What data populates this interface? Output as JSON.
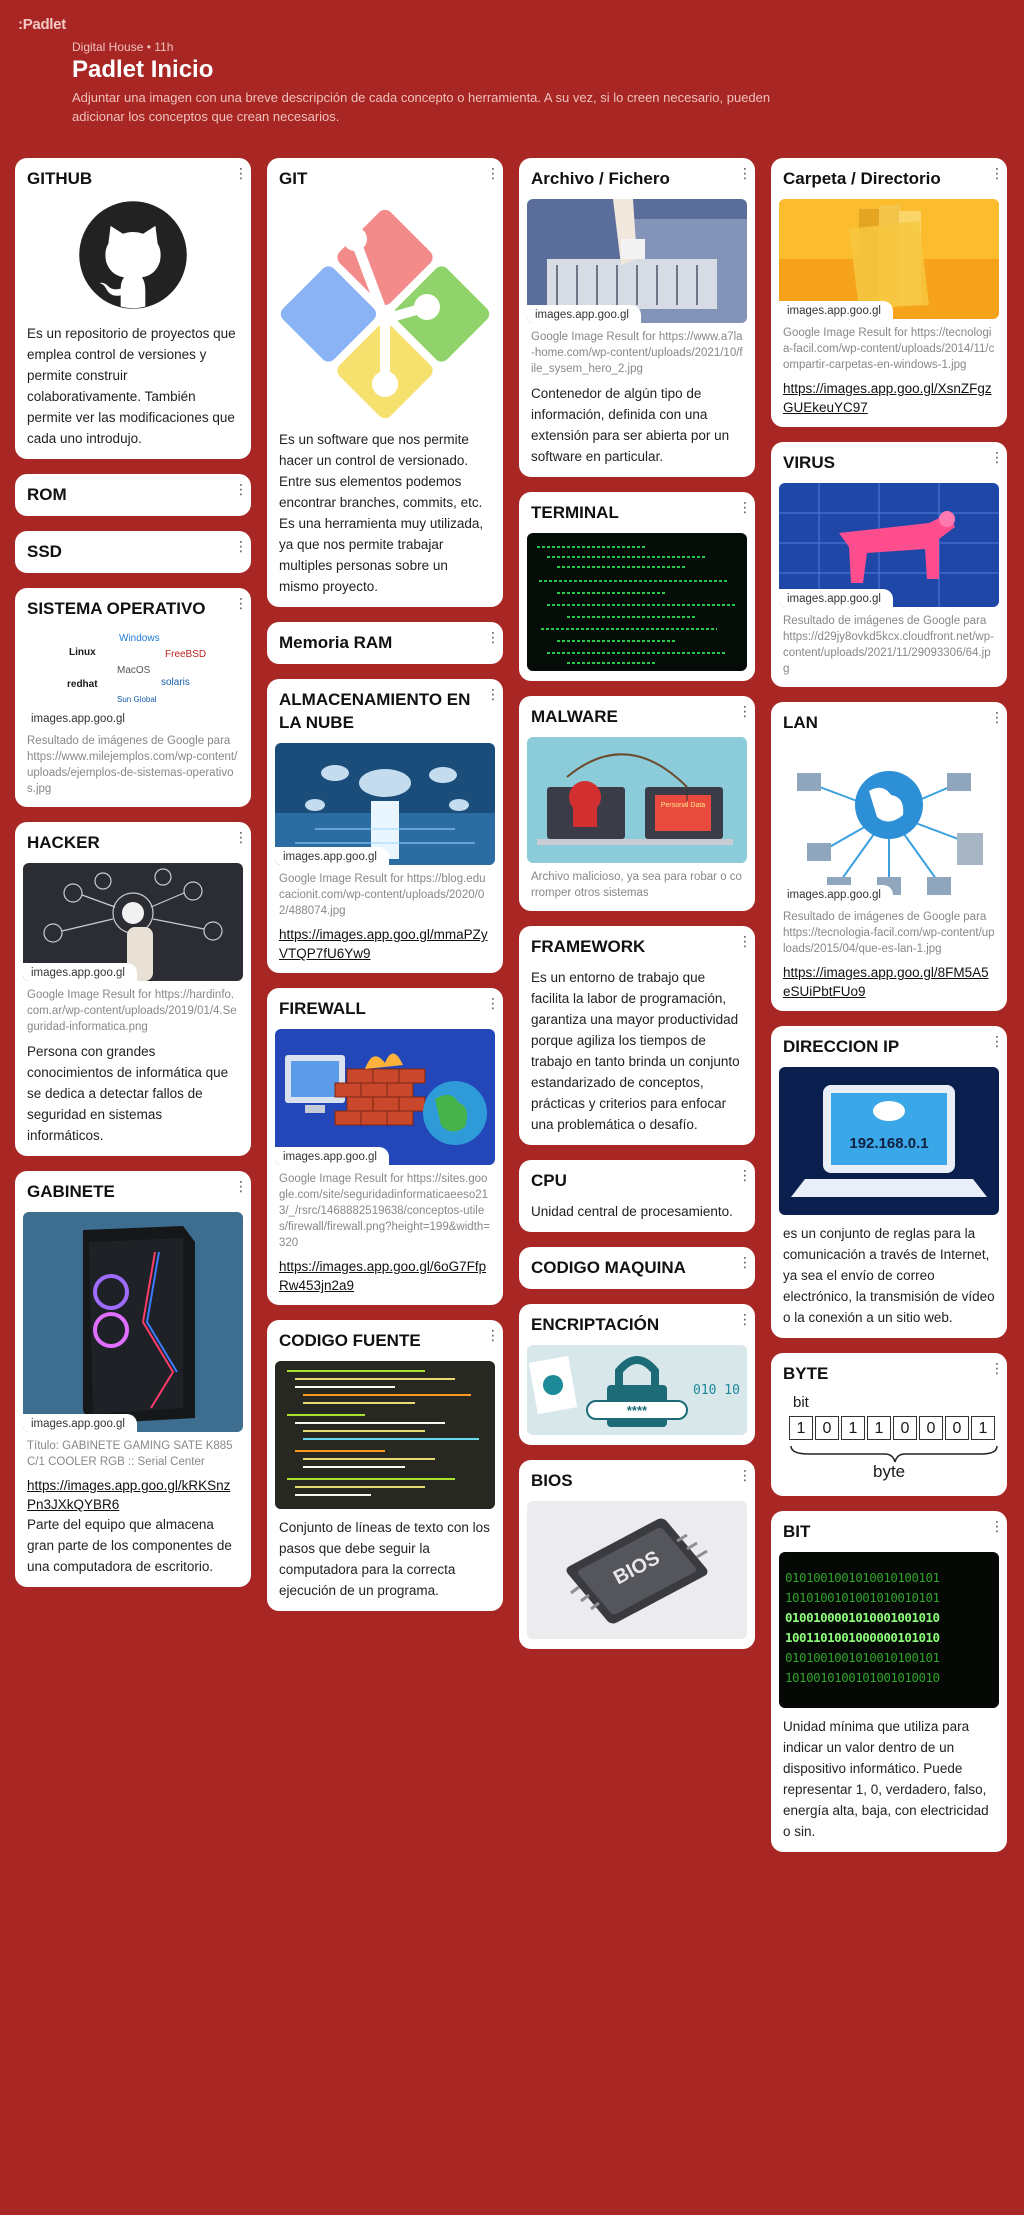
{
  "brand": {
    "logo": ":Padlet"
  },
  "header": {
    "meta": "Digital House • 11h",
    "title": "Padlet Inicio",
    "description": "Adjuntar una imagen con una breve descripción de cada concepto o herramienta. A su vez, si lo creen necesario, pueden adicionar los conceptos que crean necesarios."
  },
  "chip_label": "images.app.goo.gl",
  "more_icon": "⋮",
  "colors": {
    "background": "#a82623",
    "card": "#ffffff"
  },
  "cards": {
    "github": {
      "title": "GITHUB",
      "body": "Es un repositorio de proyectos que emplea control de versiones y permite construir colaborativamente. También permite ver las modificaciones que cada uno introdujo."
    },
    "rom": {
      "title": "ROM"
    },
    "ssd": {
      "title": "SSD"
    },
    "so": {
      "title": "SISTEMA OPERATIVO",
      "logos": [
        "Windows",
        "Linux",
        "MacOS",
        "FreeBSD",
        "redhat",
        "solaris",
        "Sun Global"
      ],
      "source": "Resultado de imágenes de Google para https://www.milejemplos.com/wp-content/uploads/ejemplos-de-sistemas-operativos.jpg"
    },
    "hacker": {
      "title": "HACKER",
      "source": "Google Image Result for https://hardinfo.com.ar/wp-content/uploads/2019/01/4.Seguridad-informatica.png",
      "body": "Persona con grandes conocimientos de informática que se dedica a detectar fallos de seguridad en sistemas informáticos."
    },
    "gabinete": {
      "title": "GABINETE",
      "source": "Título: GABINETE GAMING SATE K885 C/1 COOLER RGB :: Serial Center",
      "link": "https://images.app.goo.gl/kRKSnzPn3JXkQYBR6",
      "body": "Parte del equipo que almacena gran parte de los componentes de una computadora de escritorio."
    },
    "git": {
      "title": "GIT",
      "body": "Es un software que nos permite hacer un control de versionado. Entre sus elementos podemos encontrar branches, commits, etc. Es una herramienta muy utilizada, ya que nos permite trabajar multiples personas sobre un mismo proyecto."
    },
    "ram": {
      "title": "Memoria RAM"
    },
    "nube": {
      "title": "ALMACENAMIENTO EN LA NUBE",
      "source": "Google Image Result for https://blog.educacionit.com/wp-content/uploads/2020/02/488074.jpg",
      "link": "https://images.app.goo.gl/mmaPZyVTQP7fU6Yw9"
    },
    "firewall": {
      "title": "FIREWALL",
      "source": "Google Image Result for https://sites.google.com/site/seguridadinformaticaeeso213/_/rsrc/1468882519638/conceptos-utiles/firewall/firewall.png?height=199&width=320",
      "link": "https://images.app.goo.gl/6oG7FfpRw453jn2a9"
    },
    "fuente": {
      "title": "CODIGO FUENTE",
      "body": "Conjunto de líneas de texto con los pasos que debe seguir la computadora para la correcta ejecución de un programa."
    },
    "archivo": {
      "title": "Archivo / Fichero",
      "source": "Google Image Result for https://www.a7la-home.com/wp-content/uploads/2021/10/file_sysem_hero_2.jpg",
      "body": "Contenedor de algún tipo de información, definida con una extensión para ser abierta por un software en particular."
    },
    "terminal": {
      "title": "TERMINAL"
    },
    "malware": {
      "title": "MALWARE",
      "image_text": "Personal Data",
      "source": "Archivo malicioso, ya sea para robar o corromper otros sistemas"
    },
    "framework": {
      "title": "FRAMEWORK",
      "body": "Es un entorno de trabajo que facilita la labor de programación, garantiza una mayor productividad porque agiliza los tiempos de trabajo en tanto brinda un conjunto estandarizado de conceptos, prácticas y criterios para enfocar una problemática o desafío."
    },
    "cpu": {
      "title": "CPU",
      "body": "Unidad central de procesamiento."
    },
    "maquina": {
      "title": "CODIGO MAQUINA"
    },
    "encriptacion": {
      "title": "ENCRIPTACIÓN",
      "image_text": "****",
      "bits": "010 10"
    },
    "bios": {
      "title": "BIOS",
      "image_text": "BIOS"
    },
    "carpeta": {
      "title": "Carpeta / Directorio",
      "source": "Google Image Result for https://tecnologia-facil.com/wp-content/uploads/2014/11/compartir-carpetas-en-windows-1.jpg",
      "link": "https://images.app.goo.gl/XsnZFgzGUEkeuYC97"
    },
    "virus": {
      "title": "VIRUS",
      "source": "Resultado de imágenes de Google para https://d29jy8ovkd5kcx.cloudfront.net/wp-content/uploads/2021/11/29093306/64.jpg"
    },
    "lan": {
      "title": "LAN",
      "source": "Resultado de imágenes de Google para https://tecnologia-facil.com/wp-content/uploads/2015/04/que-es-lan-1.jpg",
      "link": "https://images.app.goo.gl/8FM5A5eSUiPbtFUo9"
    },
    "ip": {
      "title": "DIRECCION IP",
      "image_text": "192.168.0.1",
      "body": "es un conjunto de reglas para la comunicación a través de Internet, ya sea el envío de correo electrónico, la transmisión de vídeo o la conexión a un sitio web."
    },
    "byte": {
      "title": "BYTE",
      "bit_label": "bit",
      "byte_label": "byte",
      "bits": [
        "1",
        "0",
        "1",
        "1",
        "0",
        "0",
        "0",
        "1"
      ]
    },
    "bit": {
      "title": "BIT",
      "rows": [
        "0101001001010010100101",
        "1010100101001010010101",
        "0100100001010001001010",
        "1001101001000000101010",
        "0101001001010010100101",
        "1010010100101001010010"
      ],
      "body": "Unidad mínima que utiliza para indicar un valor dentro de un dispositivo informático. Puede representar 1, 0, verdadero, falso, energía alta, baja, con electricidad o sin."
    }
  }
}
